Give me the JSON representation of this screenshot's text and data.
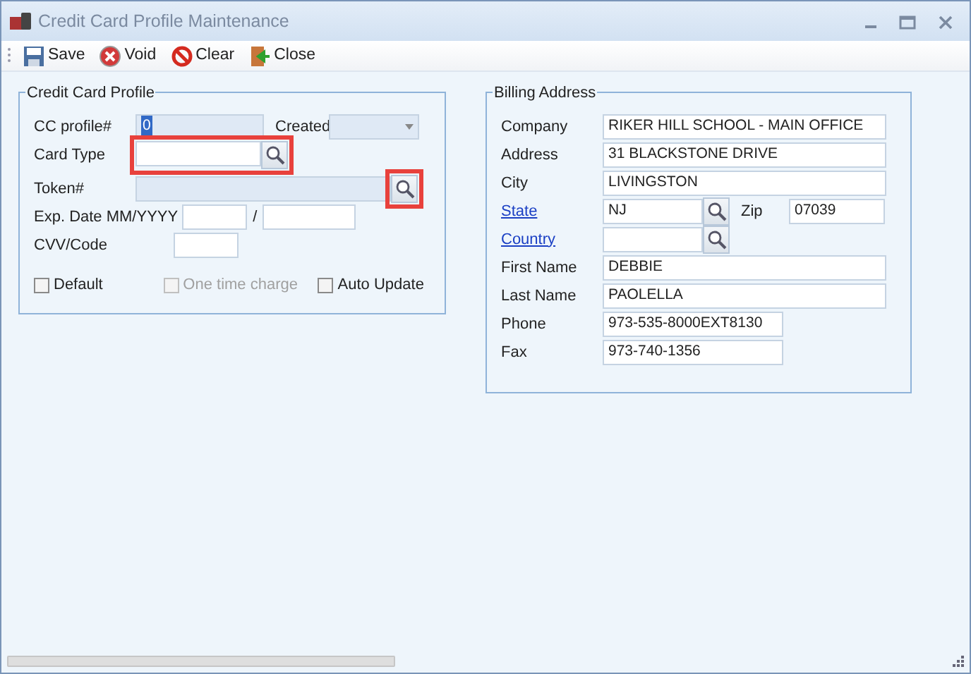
{
  "window": {
    "title": "Credit Card Profile Maintenance"
  },
  "toolbar": [
    {
      "label": "Save",
      "kind": "save"
    },
    {
      "label": "Void",
      "kind": "void"
    },
    {
      "label": "Clear",
      "kind": "clear"
    },
    {
      "label": "Close",
      "kind": "close"
    }
  ],
  "card_profile": {
    "title": "Credit Card Profile",
    "cc_profile": {
      "label": "CC profile#",
      "value": "0"
    },
    "created": {
      "label": "Created"
    },
    "card_type": {
      "label": "Card Type",
      "highlighted": true
    },
    "token": {
      "label": "Token#",
      "highlighted": true
    },
    "exp_date": {
      "label": "Exp. Date MM/YYYY",
      "separator": "/"
    },
    "cvv": {
      "label": "CVV/Code"
    },
    "checkboxes": [
      {
        "label": "Default",
        "checked": false,
        "disabled": false
      },
      {
        "label": "One time charge",
        "checked": false,
        "disabled": true
      },
      {
        "label": "Auto Update",
        "checked": false,
        "disabled": false
      }
    ]
  },
  "billing_address": {
    "title": "Billing Address",
    "fields": [
      {
        "label": "Company",
        "value": "RIKER HILL SCHOOL - MAIN OFFICE",
        "kind": "wide",
        "link": false
      },
      {
        "label": "Address",
        "value": "31 BLACKSTONE DRIVE",
        "kind": "wide",
        "link": false
      },
      {
        "label": "City",
        "value": "LIVINGSTON",
        "kind": "wide",
        "link": false
      },
      {
        "label": "State",
        "value": "NJ",
        "kind": "lookup",
        "link": true,
        "extra": {
          "label": "Zip",
          "value": "07039"
        }
      },
      {
        "label": "Country",
        "kind": "lookup",
        "link": true
      },
      {
        "label": "First Name",
        "value": "DEBBIE",
        "kind": "wide",
        "link": false
      },
      {
        "label": "Last Name",
        "value": "PAOLELLA",
        "kind": "wide",
        "link": false
      },
      {
        "label": "Phone",
        "value": "973-535-8000EXT8130",
        "kind": "short",
        "link": false
      },
      {
        "label": "Fax",
        "value": "973-740-1356",
        "kind": "short",
        "link": false
      }
    ]
  }
}
